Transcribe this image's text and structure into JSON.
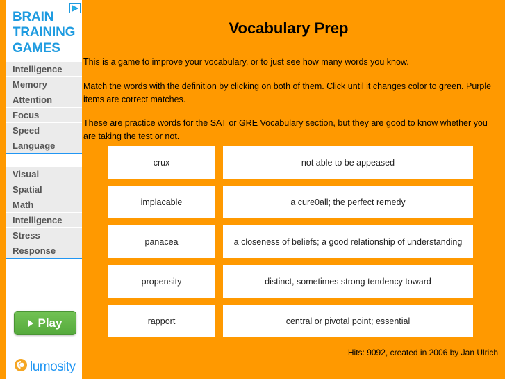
{
  "colors": {
    "background_orange": "#FF9900",
    "brand_blue": "#1E9BE0",
    "accent_blue": "#2196F3",
    "play_green": "#5CB944",
    "nav_gray": "#EBEBEB",
    "card_white": "#FFFFFF"
  },
  "sidebar": {
    "adchoices_icon": "adchoices-triangle-icon",
    "brand": {
      "line1": "BRAIN",
      "line2": "TRAINING",
      "line3": "GAMES"
    },
    "group1": [
      {
        "label": "Intelligence"
      },
      {
        "label": "Memory"
      },
      {
        "label": "Attention"
      },
      {
        "label": "Focus"
      },
      {
        "label": "Speed"
      },
      {
        "label": "Language"
      }
    ],
    "group2": [
      {
        "label": "Visual"
      },
      {
        "label": "Spatial"
      },
      {
        "label": "Math"
      },
      {
        "label": "Intelligence"
      },
      {
        "label": "Stress"
      },
      {
        "label": "Response"
      }
    ],
    "play_button": {
      "label": "Play",
      "icon": "play-triangle-icon"
    },
    "logo": {
      "icon": "lumosity-head-icon",
      "text": "lumosity"
    }
  },
  "main": {
    "title": "Vocabulary Prep",
    "intro1": "This is a game to improve your vocabulary, or to just see how many words you know.",
    "intro2": "Match the words with the definition by clicking on both of them. Click until it changes color to green. Purple items are correct matches.",
    "intro3": "These are practice words for the SAT or GRE Vocabulary section, but they are good to know whether you are taking the test or not.",
    "rows": [
      {
        "word": "crux",
        "definition": "not able to be appeased"
      },
      {
        "word": "implacable",
        "definition": "a cure0all; the perfect remedy"
      },
      {
        "word": "panacea",
        "definition": "a closeness of beliefs; a good relationship of understanding"
      },
      {
        "word": "propensity",
        "definition": "distinct, sometimes strong tendency toward"
      },
      {
        "word": "rapport",
        "definition": "central or pivotal point; essential"
      }
    ],
    "footer_credit": "Hits: 9092, created in 2006 by Jan Ulrich"
  }
}
